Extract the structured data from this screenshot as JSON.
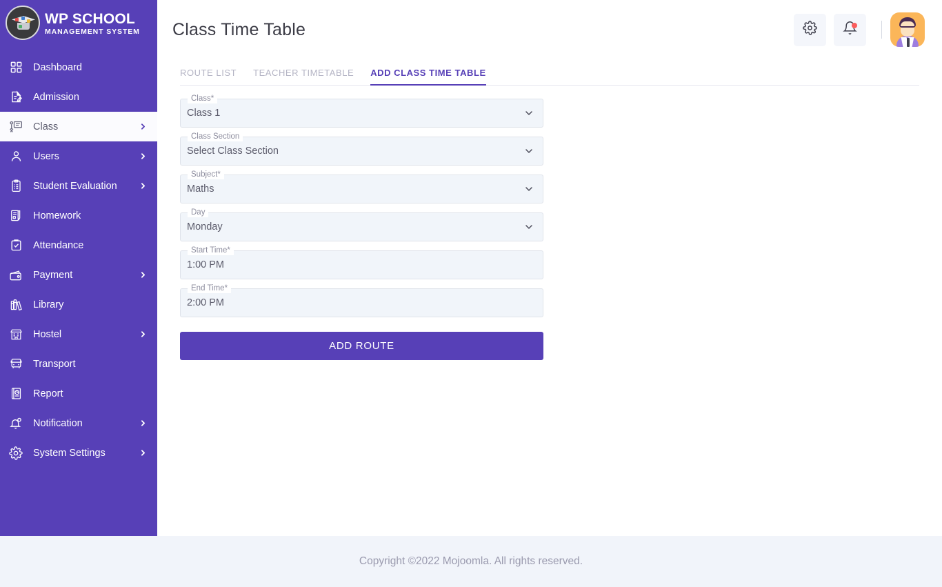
{
  "brand": {
    "title": "WP SCHOOL",
    "subtitle": "MANAGEMENT SYSTEM",
    "logo_icon": "graduation-cap-logo"
  },
  "sidebar": {
    "background_color": "#5740b7",
    "items": [
      {
        "label": "Dashboard",
        "icon": "grid-icon",
        "has_chevron": false,
        "active": false
      },
      {
        "label": "Admission",
        "icon": "document-pen-icon",
        "has_chevron": false,
        "active": false
      },
      {
        "label": "Class",
        "icon": "teacher-board-icon",
        "has_chevron": true,
        "active": true
      },
      {
        "label": "Users",
        "icon": "user-icon",
        "has_chevron": true,
        "active": false
      },
      {
        "label": "Student Evaluation",
        "icon": "clipboard-list-icon",
        "has_chevron": true,
        "active": false
      },
      {
        "label": "Homework",
        "icon": "book-pen-icon",
        "has_chevron": false,
        "active": false
      },
      {
        "label": "Attendance",
        "icon": "clipboard-check-icon",
        "has_chevron": false,
        "active": false
      },
      {
        "label": "Payment",
        "icon": "wallet-icon",
        "has_chevron": true,
        "active": false
      },
      {
        "label": "Library",
        "icon": "books-icon",
        "has_chevron": false,
        "active": false
      },
      {
        "label": "Hostel",
        "icon": "building-icon",
        "has_chevron": true,
        "active": false
      },
      {
        "label": "Transport",
        "icon": "bus-icon",
        "has_chevron": false,
        "active": false
      },
      {
        "label": "Report",
        "icon": "report-chart-icon",
        "has_chevron": false,
        "active": false
      },
      {
        "label": "Notification",
        "icon": "bell-alert-icon",
        "has_chevron": true,
        "active": false
      },
      {
        "label": "System Settings",
        "icon": "gear-icon",
        "has_chevron": true,
        "active": false
      }
    ]
  },
  "header": {
    "title": "Class Time Table",
    "settings_icon": "gear-icon",
    "notifications_icon": "bell-icon",
    "notification_badge": true,
    "avatar_icon": "user-avatar"
  },
  "tabs": [
    {
      "label": "ROUTE LIST",
      "active": false
    },
    {
      "label": "TEACHER TIMETABLE",
      "active": false
    },
    {
      "label": "ADD CLASS TIME TABLE",
      "active": true
    }
  ],
  "form": {
    "fields": [
      {
        "legend": "Class*",
        "value": "Class 1",
        "control": "select",
        "icon": "chevron-down-icon"
      },
      {
        "legend": "Class Section",
        "value": "Select Class Section",
        "control": "select",
        "icon": "chevron-down-icon"
      },
      {
        "legend": "Subject*",
        "value": "Maths",
        "control": "select",
        "icon": "chevron-down-icon"
      },
      {
        "legend": "Day",
        "value": "Monday",
        "control": "select",
        "icon": "chevron-down-icon"
      },
      {
        "legend": "Start Time*",
        "value": "1:00 PM",
        "control": "text",
        "icon": ""
      },
      {
        "legend": "End Time*",
        "value": "2:00 PM",
        "control": "text",
        "icon": ""
      }
    ],
    "submit_label": "ADD ROUTE"
  },
  "footer": {
    "text": "Copyright ©2022 Mojoomla. All rights reserved."
  },
  "colors": {
    "brand_purple": "#5740b7",
    "field_bg": "#f1f5fa",
    "footer_bg": "#f1f4fa",
    "accent_red": "#fb5d5d",
    "avatar_orange": "#fbb659"
  }
}
